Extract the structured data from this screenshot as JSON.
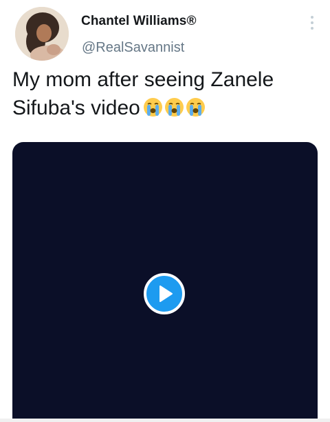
{
  "author": {
    "display_name": "Chantel Williams®",
    "handle": "@RealSavannist"
  },
  "tweet": {
    "text": "My mom after seeing Zanele Sifuba's video",
    "emojis": [
      "loudly-crying-face",
      "loudly-crying-face",
      "loudly-crying-face"
    ]
  },
  "media": {
    "type": "video",
    "play_icon": "play-icon"
  },
  "icons": {
    "menu": "more-vertical-icon"
  },
  "colors": {
    "accent": "#1d9bf0",
    "text_primary": "#14171a",
    "text_secondary": "#657786",
    "video_bg": "#0b0f28"
  }
}
